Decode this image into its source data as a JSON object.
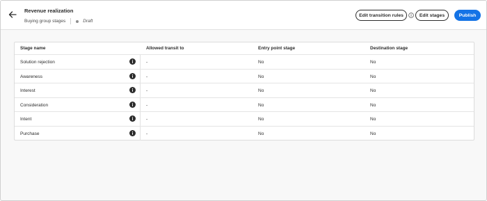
{
  "header": {
    "title": "Revenue realization",
    "subtitle": "Buying group stages",
    "status": "Draft",
    "edit_transition_label": "Edit transition rules",
    "edit_stages_label": "Edit stages",
    "publish_label": "Publish"
  },
  "table": {
    "columns": [
      "Stage name",
      "Allowed transit to",
      "Entry point stage",
      "Destination stage"
    ],
    "rows": [
      {
        "name": "Solution rejection",
        "transit": "-",
        "entry": "No",
        "destination": "No"
      },
      {
        "name": "Awareness",
        "transit": "-",
        "entry": "No",
        "destination": "No"
      },
      {
        "name": "Interest",
        "transit": "-",
        "entry": "No",
        "destination": "No"
      },
      {
        "name": "Consideration",
        "transit": "-",
        "entry": "No",
        "destination": "No"
      },
      {
        "name": "Intent",
        "transit": "-",
        "entry": "No",
        "destination": "No"
      },
      {
        "name": "Purchase",
        "transit": "-",
        "entry": "No",
        "destination": "No"
      }
    ]
  },
  "colors": {
    "primary": "#1473e6",
    "text": "#2c2c2c",
    "status_dot": "#8e8e8e"
  },
  "icons": {
    "back": "arrow-left-icon",
    "help": "info-outline-icon",
    "row_info": "info-filled-icon"
  }
}
